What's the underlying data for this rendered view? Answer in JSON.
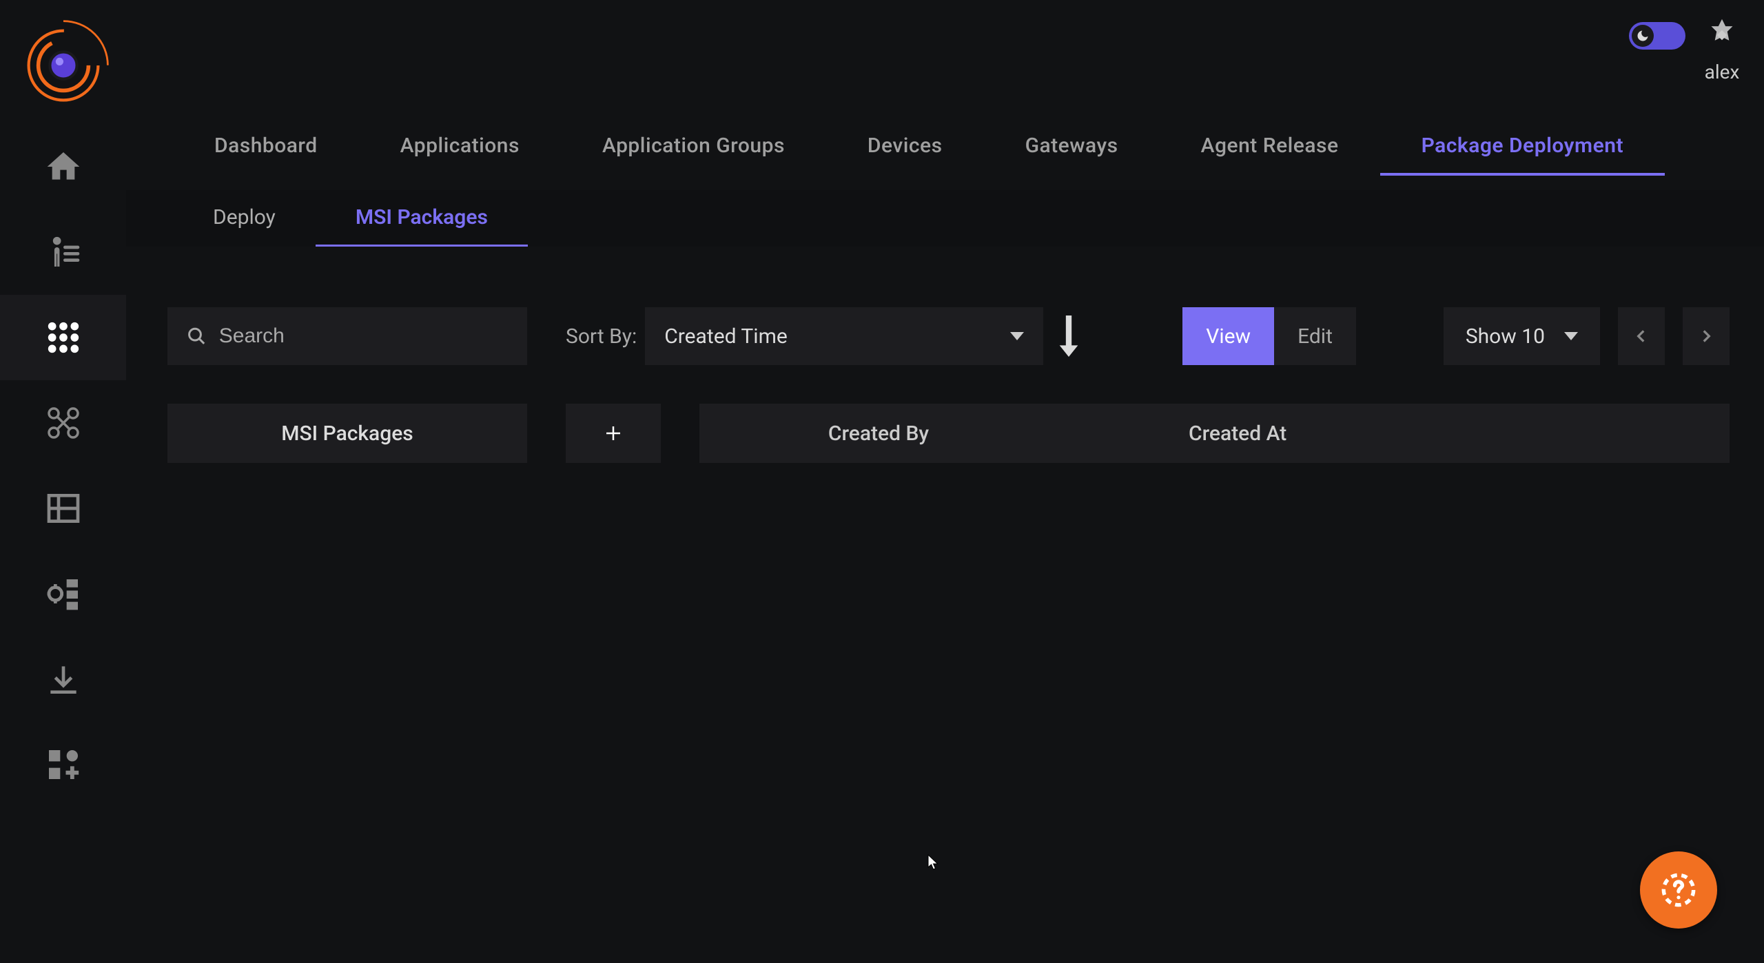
{
  "user": {
    "name": "alex"
  },
  "sidebar": {
    "active_index": 2
  },
  "topnav": {
    "items": [
      {
        "label": "Dashboard"
      },
      {
        "label": "Applications"
      },
      {
        "label": "Application Groups"
      },
      {
        "label": "Devices"
      },
      {
        "label": "Gateways"
      },
      {
        "label": "Agent Release"
      },
      {
        "label": "Package Deployment"
      }
    ],
    "active_index": 6
  },
  "subnav": {
    "items": [
      {
        "label": "Deploy"
      },
      {
        "label": "MSI Packages"
      }
    ],
    "active_index": 1
  },
  "toolbar": {
    "search_placeholder": "Search",
    "sort_label": "Sort By:",
    "sort_value": "Created Time",
    "view_button": "View",
    "edit_button": "Edit",
    "show_label": "Show 10"
  },
  "table": {
    "title": "MSI Packages",
    "columns": [
      {
        "label": "Created By"
      },
      {
        "label": "Created At"
      }
    ],
    "rows": []
  }
}
